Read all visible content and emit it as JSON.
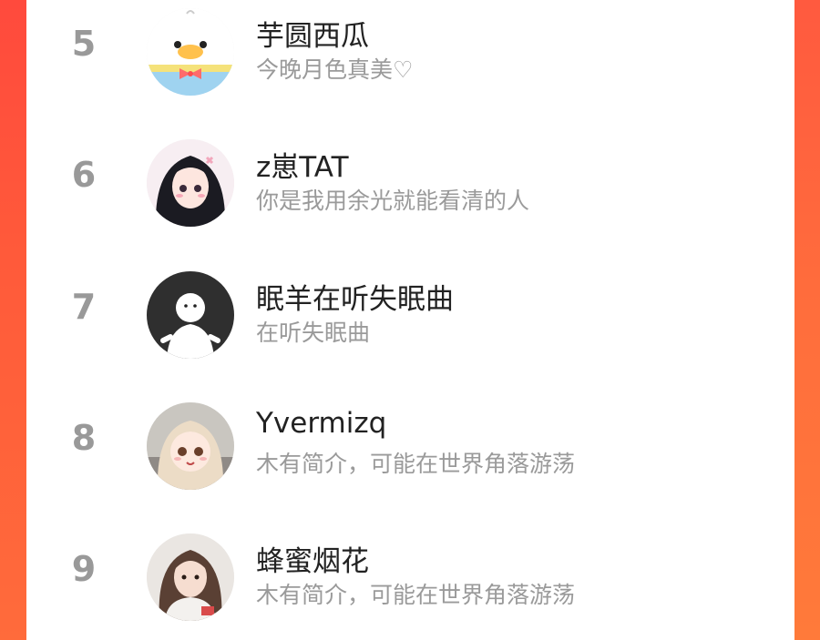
{
  "users": [
    {
      "rank": "5",
      "name": "芋圆西瓜",
      "bio": "今晚月色真美♡",
      "avatar_icon": "duck-avatar-icon"
    },
    {
      "rank": "6",
      "name": "z崽TAT",
      "bio": "你是我用余光就能看清的人",
      "avatar_icon": "anime-girl-avatar-icon"
    },
    {
      "rank": "7",
      "name": "眠羊在听失眠曲",
      "bio": "在听失眠曲",
      "avatar_icon": "default-person-avatar-icon"
    },
    {
      "rank": "8",
      "name": "Yvermizq",
      "bio": "木有简介，可能在世界角落游荡",
      "avatar_icon": "anime-girl-cream-avatar-icon"
    },
    {
      "rank": "9",
      "name": "蜂蜜烟花",
      "bio": "木有简介，可能在世界角落游荡",
      "avatar_icon": "photo-girl-avatar-icon"
    }
  ],
  "colors": {
    "accent_left": "#ff4a3d",
    "accent_right": "#ff7a3a",
    "rank": "#999999",
    "name": "#222222",
    "bio": "#9a9a9a"
  }
}
